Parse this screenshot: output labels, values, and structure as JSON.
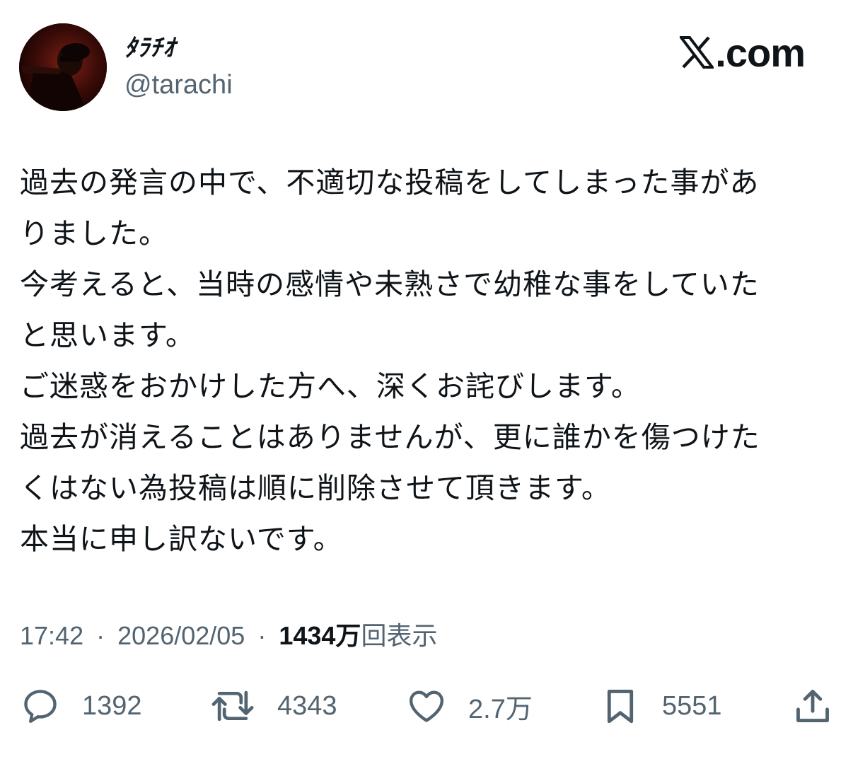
{
  "author": {
    "display_name": "ﾀﾗﾁｵ",
    "handle": "@tarachi"
  },
  "brand": {
    "text": ".com"
  },
  "tweet": {
    "lines": [
      "過去の発言の中で、不適切な投稿をしてしまった事があ",
      "りました。",
      "今考えると、当時の感情や未熟さで幼稚な事をしていた",
      "と思います。",
      "ご迷惑をおかけした方へ、深くお詫びします。",
      "過去が消えることはありませんが、更に誰かを傷つけた",
      "くはない為投稿は順に削除させて頂きます。",
      "本当に申し訳ないです。"
    ]
  },
  "meta": {
    "time": "17:42",
    "separator": "·",
    "date": "2026/02/05",
    "views_count": "1434万",
    "views_label": "回表示"
  },
  "actions": {
    "replies": "1392",
    "reposts": "4343",
    "likes": "2.7万",
    "bookmarks": "5551"
  },
  "icons": {
    "reply": "reply-icon",
    "repost": "repost-icon",
    "like": "heart-icon",
    "bookmark": "bookmark-icon",
    "share": "share-icon"
  }
}
